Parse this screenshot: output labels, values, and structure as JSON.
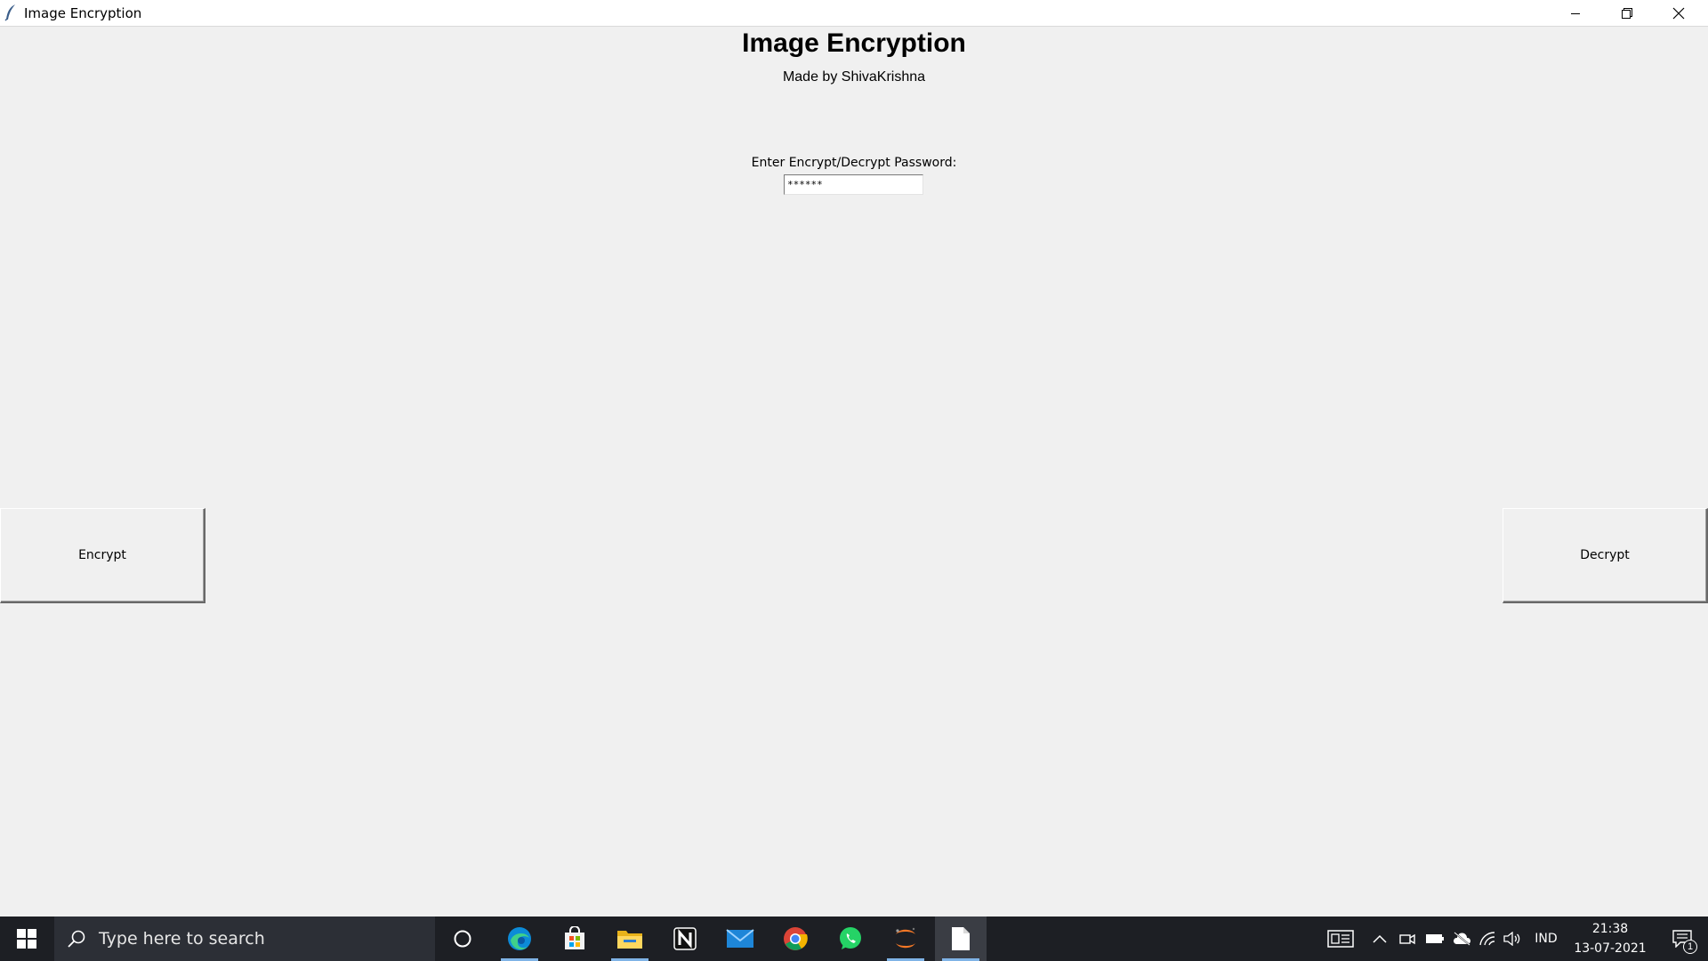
{
  "window": {
    "title": "Image Encryption",
    "app_icon": "feather-icon",
    "controls": [
      "minimize-icon",
      "restore-icon",
      "close-icon"
    ]
  },
  "app": {
    "heading": "Image Encryption",
    "subtitle": "Made by ShivaKrishna",
    "password_label": "Enter Encrypt/Decrypt Password:",
    "password_value": "******",
    "encrypt_label": "Encrypt",
    "decrypt_label": "Decrypt"
  },
  "taskbar": {
    "search_placeholder": "Type here to search",
    "pinned": [
      {
        "name": "cortana-icon",
        "active": false
      },
      {
        "name": "edge-icon",
        "active": true
      },
      {
        "name": "store-icon",
        "active": false
      },
      {
        "name": "file-explorer-icon",
        "active": true
      },
      {
        "name": "notion-icon",
        "active": false
      },
      {
        "name": "mail-icon",
        "active": false
      },
      {
        "name": "chrome-icon",
        "active": false
      },
      {
        "name": "whatsapp-icon",
        "active": false
      },
      {
        "name": "jupyter-icon",
        "active": true
      },
      {
        "name": "document-icon",
        "active": true
      }
    ],
    "tray": {
      "language": "IND",
      "time": "21:38",
      "date": "13-07-2021",
      "notification_count": "1"
    }
  },
  "colors": {
    "background": "#f0f0f0",
    "taskbar": "#1d1f24",
    "active_indicator": "#7fb3e6"
  }
}
